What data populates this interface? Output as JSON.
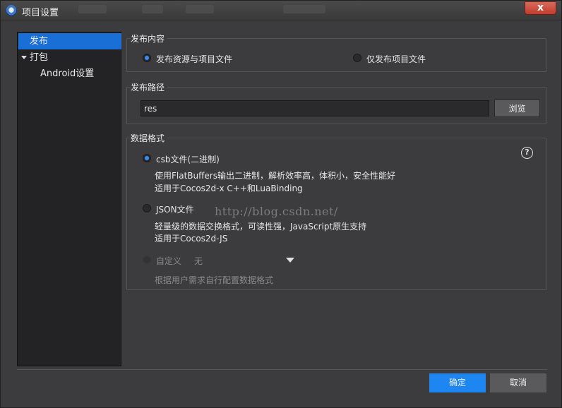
{
  "window": {
    "title": "项目设置",
    "close_label": "x"
  },
  "sidebar": {
    "items": [
      {
        "label": "发布"
      },
      {
        "label": "打包"
      },
      {
        "label": "Android设置"
      }
    ]
  },
  "publish_content": {
    "group_label": "发布内容",
    "options": [
      {
        "label": "发布资源与项目文件",
        "checked": true
      },
      {
        "label": "仅发布项目文件",
        "checked": false
      }
    ]
  },
  "publish_path": {
    "group_label": "发布路径",
    "value": "res",
    "browse_label": "浏览"
  },
  "data_format": {
    "group_label": "数据格式",
    "help_label": "?",
    "csb": {
      "label": "csb文件(二进制)",
      "desc1": "使用FlatBuffers输出二进制，解析效率高，体积小，安全性能好",
      "desc2": "适用于Cocos2d-x C++和LuaBinding"
    },
    "json": {
      "label": "JSON文件",
      "desc1": "轻量级的数据交换格式，可读性强，JavaScript原生支持",
      "desc2": "适用于Cocos2d-JS"
    },
    "custom": {
      "label": "自定义",
      "selected": "无",
      "desc": "根据用户需求自行配置数据格式"
    }
  },
  "watermark": "http://blog.csdn.net/",
  "footer": {
    "ok_label": "确定",
    "cancel_label": "取消"
  },
  "colors": {
    "accent": "#1e86f0",
    "selection": "#1a6fd6"
  }
}
